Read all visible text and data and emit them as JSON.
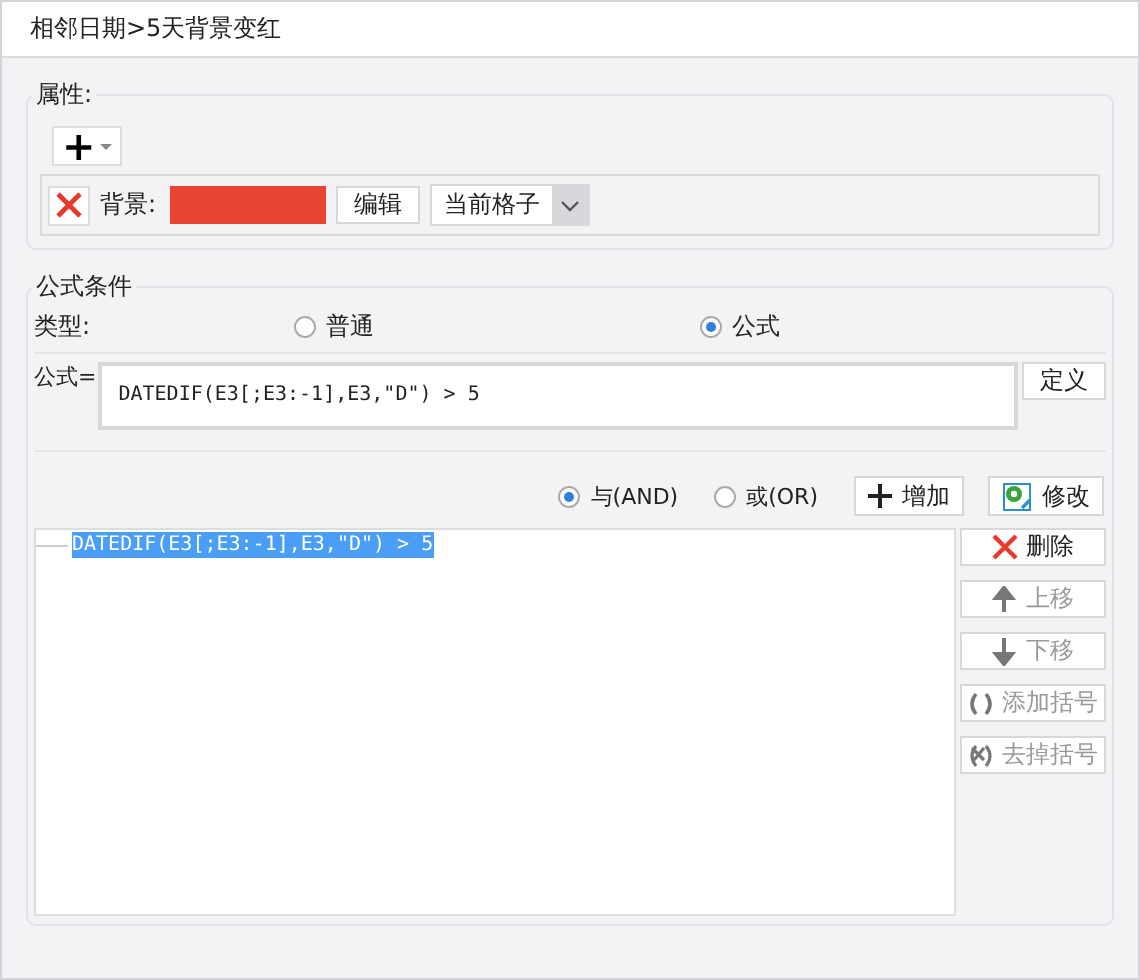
{
  "window": {
    "title": "相邻日期>5天背景变红"
  },
  "properties": {
    "legend": "属性:",
    "add_button": "+",
    "items": [
      {
        "label": "背景:",
        "color": "#e94432",
        "edit_button": "编辑",
        "scope": "当前格子"
      }
    ]
  },
  "conditions": {
    "legend": "公式条件",
    "type_label": "类型:",
    "types": [
      {
        "label": "普通",
        "selected": false
      },
      {
        "label": "公式",
        "selected": true
      }
    ],
    "formula_label": "公式=",
    "formula": "DATEDIF(E3[;E3:-1],E3,\"D\") > 5",
    "define_button": "定义",
    "logic": [
      {
        "label": "与(AND)",
        "selected": true
      },
      {
        "label": "或(OR)",
        "selected": false
      }
    ],
    "add_button": "增加",
    "modify_button": "修改",
    "list": [
      {
        "text": "DATEDIF(E3[;E3:-1],E3,\"D\") > 5",
        "selected": true
      }
    ],
    "actions": [
      {
        "kind": "delete",
        "label": "删除",
        "disabled": false
      },
      {
        "kind": "up",
        "label": "上移",
        "disabled": true
      },
      {
        "kind": "down",
        "label": "下移",
        "disabled": true
      },
      {
        "kind": "add-paren",
        "label": "添加括号",
        "disabled": true
      },
      {
        "kind": "remove-paren",
        "label": "去掉括号",
        "disabled": true
      }
    ]
  }
}
